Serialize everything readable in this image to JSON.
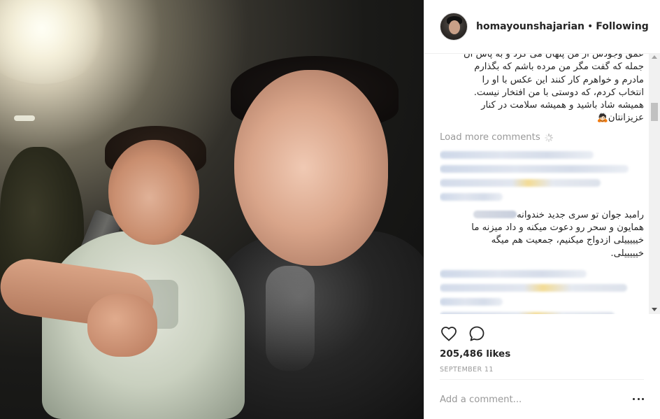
{
  "header": {
    "username": "homayounshajarian",
    "separator": "•",
    "follow_state": "Following"
  },
  "caption": {
    "lines": [
      "عمق وجودش از من پنهان می کرد و به پاس آن",
      "جمله که گفت مگر من مرده باشم که بگذارم",
      "مادرم و خواهرم کار کنند این عکس با او را",
      "انتخاب کردم، که دوستی با من افتخار نیست.",
      "همیشه شاد باشید و همیشه سلامت در کنار",
      "عزیزانتان🙇🏻"
    ]
  },
  "load_more": {
    "label": "Load more comments"
  },
  "visible_comment": {
    "lines": [
      "رامبد جوان تو سری جدید خندوانه",
      "همایون و سحر رو دعوت میکنه و داد میزنه ما",
      "خیییییلی ازدواج میکنیم، جمعیت هم میگه",
      "خیییییلی."
    ]
  },
  "actions": {
    "like_icon": "heart-outline-icon",
    "comment_icon": "speech-bubble-icon"
  },
  "likes": {
    "text": "205,486 likes"
  },
  "date": {
    "text": "SEPTEMBER 11"
  },
  "add_comment": {
    "placeholder": "Add a comment...",
    "more_icon": "ellipsis-icon"
  },
  "colors": {
    "text": "#262626",
    "muted": "#999999",
    "border": "#efefef"
  }
}
